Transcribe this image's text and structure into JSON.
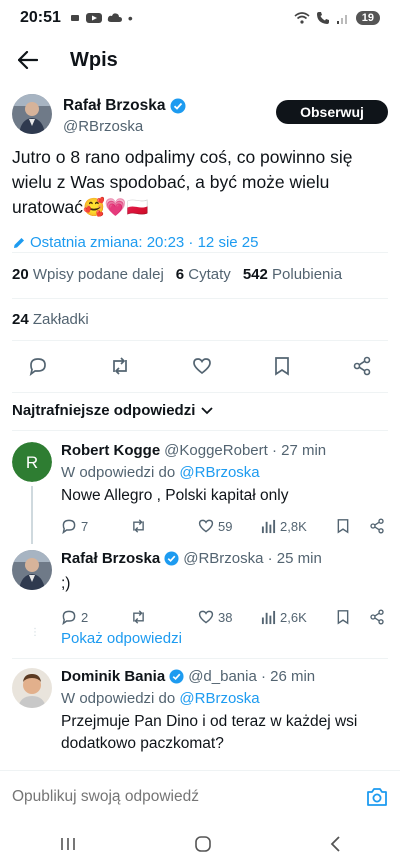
{
  "status_bar": {
    "time": "20:51",
    "battery": "19"
  },
  "header": {
    "title": "Wpis"
  },
  "tweet": {
    "author_name": "Rafał Brzoska",
    "author_handle": "@RBrzoska",
    "follow_label": "Obserwuj",
    "text": "Jutro o 8 rano odpalimy coś, co powinno się wielu z Was spodobać, a być może wielu uratować🥰💗🇵🇱",
    "edited": "Ostatnia zmiana: 20:23 · 12 sie 25",
    "reposts_count": "20",
    "reposts_label": "Wpisy podane dalej",
    "quotes_count": "6",
    "quotes_label": "Cytaty",
    "likes_count": "542",
    "likes_label": "Polubienia",
    "bookmarks_count": "24",
    "bookmarks_label": "Zakładki"
  },
  "sort_label": "Najtrafniejsze odpowiedzi",
  "replies": [
    {
      "name": "Robert Kogge",
      "meta": "@KoggeRobert · 27 min",
      "in_reply_prefix": "W odpowiedzi do ",
      "in_reply_handle": "@RBrzoska",
      "text": "Nowe Allegro , Polski kapitał only",
      "replies": "7",
      "retweets": "",
      "likes": "59",
      "views": "2,8K",
      "avatar_letter": "R",
      "avatar_color": "#2e7d32"
    },
    {
      "name": "Rafał Brzoska",
      "meta": "@RBrzoska · 25 min",
      "text": ";)",
      "replies": "2",
      "retweets": "",
      "likes": "38",
      "views": "2,6K"
    },
    {
      "name": "Dominik Bania",
      "meta": "@d_bania · 26 min",
      "in_reply_prefix": "W odpowiedzi do ",
      "in_reply_handle": "@RBrzoska",
      "text": "Przejmuje Pan Dino i od teraz w każdej wsi dodatkowo paczkomat?"
    }
  ],
  "show_replies": "Pokaż odpowiedzi",
  "composer": {
    "placeholder": "Opublikuj swoją odpowiedź"
  },
  "colors": {
    "accent": "#1d9bf0",
    "text": "#0f1419",
    "secondary": "#536471"
  }
}
